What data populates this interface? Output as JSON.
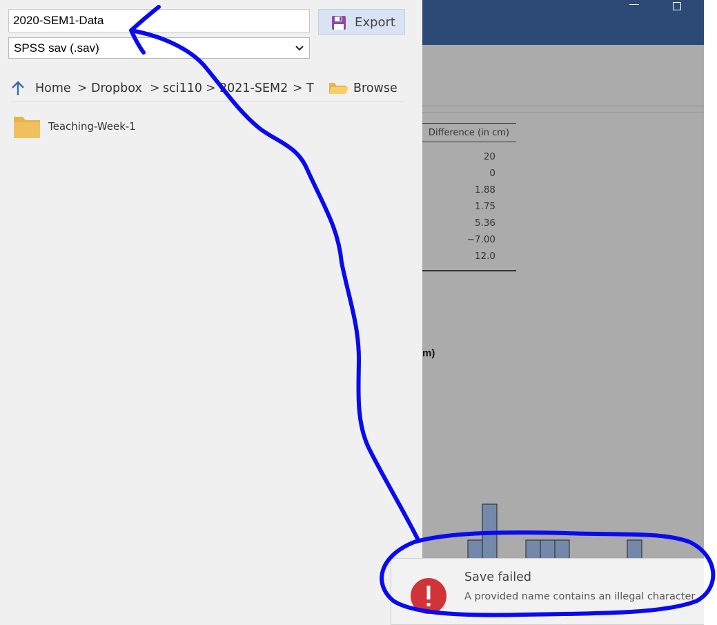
{
  "export_panel": {
    "filename_value": "2020-SEM1-Data",
    "format_selected": "SPSS sav (.sav)",
    "export_label": "Export",
    "breadcrumb": [
      "Home",
      "Dropbox",
      "sci110",
      "2021-SEM2",
      "T"
    ],
    "browse_label": "Browse",
    "folders": [
      "Teaching-Week-1"
    ]
  },
  "results": {
    "column_header": "Difference (in cm)",
    "values": [
      "20",
      "0",
      "1.88",
      "1.75",
      "5.36",
      "−7.00",
      "12.0"
    ],
    "chart_title_fragment": "m)"
  },
  "chart_data": {
    "type": "bar",
    "title": "",
    "xlabel": "",
    "ylabel": "",
    "values": [
      1,
      1,
      0,
      3,
      5,
      1,
      1,
      3,
      3,
      3,
      0,
      1,
      1,
      0,
      3
    ],
    "note_visible_counts_are_partial": true
  },
  "toast": {
    "title": "Save failed",
    "message": "A provided name contains an illegal character"
  },
  "colors": {
    "title_bar": "#2d4a76",
    "export_button_bg": "#dae3f3",
    "error_red": "#d13438",
    "annotation_blue": "#0a0af0",
    "histogram_fill": "#7489aa"
  }
}
